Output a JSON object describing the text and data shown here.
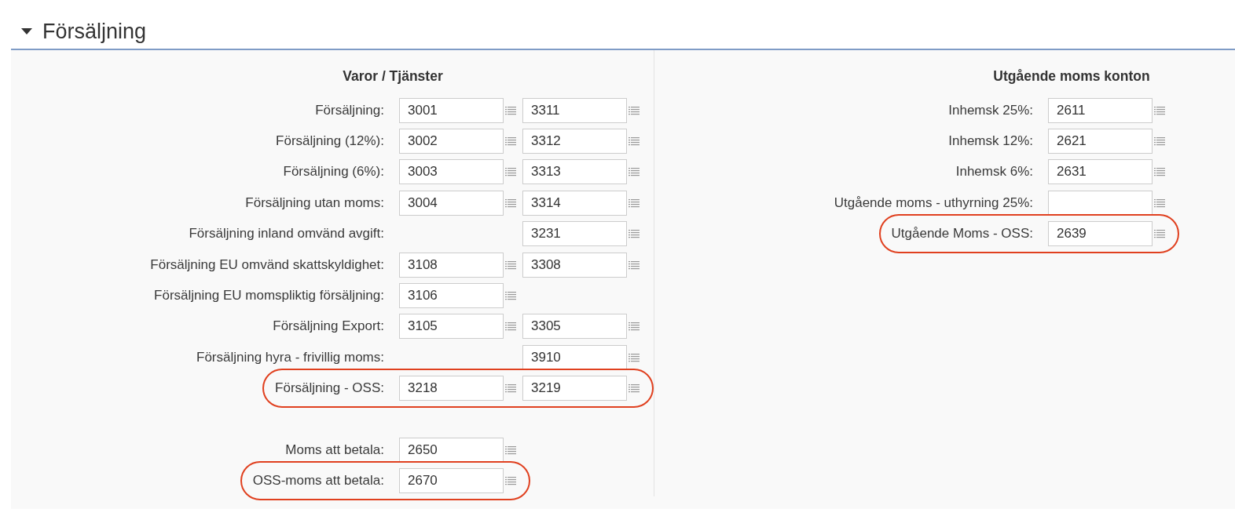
{
  "section": {
    "title": "Försäljning",
    "expanded": true,
    "left": {
      "heading": "Varor / Tjänster",
      "rows": [
        {
          "label": "Försäljning:",
          "highlighted": false,
          "accounts": [
            {
              "kind": "field",
              "value": "3001"
            },
            {
              "kind": "field",
              "value": "3311"
            }
          ]
        },
        {
          "label": "Försäljning (12%):",
          "highlighted": false,
          "accounts": [
            {
              "kind": "field",
              "value": "3002"
            },
            {
              "kind": "field",
              "value": "3312"
            }
          ]
        },
        {
          "label": "Försäljning (6%):",
          "highlighted": false,
          "accounts": [
            {
              "kind": "field",
              "value": "3003"
            },
            {
              "kind": "field",
              "value": "3313"
            }
          ]
        },
        {
          "label": "Försäljning utan moms:",
          "highlighted": false,
          "accounts": [
            {
              "kind": "field",
              "value": "3004"
            },
            {
              "kind": "field",
              "value": "3314"
            }
          ]
        },
        {
          "label": "Försäljning inland omvänd avgift:",
          "highlighted": false,
          "accounts": [
            {
              "kind": "blank"
            },
            {
              "kind": "field",
              "value": "3231"
            }
          ]
        },
        {
          "label": "Försäljning EU omvänd skattskyldighet:",
          "highlighted": false,
          "accounts": [
            {
              "kind": "field",
              "value": "3108"
            },
            {
              "kind": "field",
              "value": "3308"
            }
          ]
        },
        {
          "label": "Försäljning EU momspliktig försäljning:",
          "highlighted": false,
          "accounts": [
            {
              "kind": "field",
              "value": "3106"
            },
            {
              "kind": "blank"
            }
          ]
        },
        {
          "label": "Försäljning Export:",
          "highlighted": false,
          "accounts": [
            {
              "kind": "field",
              "value": "3105"
            },
            {
              "kind": "field",
              "value": "3305"
            }
          ]
        },
        {
          "label": "Försäljning hyra - frivillig moms:",
          "highlighted": false,
          "accounts": [
            {
              "kind": "blank"
            },
            {
              "kind": "field",
              "value": "3910"
            }
          ]
        },
        {
          "label": "Försäljning - OSS:",
          "highlighted": true,
          "accounts": [
            {
              "kind": "field",
              "value": "3218"
            },
            {
              "kind": "field",
              "value": "3219"
            }
          ]
        }
      ],
      "payment_rows": [
        {
          "label": "Moms att betala:",
          "highlighted": false,
          "accounts": [
            {
              "kind": "field",
              "value": "2650"
            },
            {
              "kind": "blank"
            }
          ]
        },
        {
          "label": "OSS-moms att betala:",
          "highlighted": true,
          "accounts": [
            {
              "kind": "field",
              "value": "2670"
            },
            {
              "kind": "blank"
            }
          ]
        }
      ]
    },
    "right": {
      "heading": "Utgående moms konton",
      "rows": [
        {
          "label": "Inhemsk 25%:",
          "highlighted": false,
          "accounts": [
            {
              "kind": "field",
              "value": "2611"
            }
          ]
        },
        {
          "label": "Inhemsk 12%:",
          "highlighted": false,
          "accounts": [
            {
              "kind": "field",
              "value": "2621"
            }
          ]
        },
        {
          "label": "Inhemsk 6%:",
          "highlighted": false,
          "accounts": [
            {
              "kind": "field",
              "value": "2631"
            }
          ]
        },
        {
          "label": "Utgående moms - uthyrning 25%:",
          "highlighted": false,
          "accounts": [
            {
              "kind": "field"
            }
          ]
        },
        {
          "label": "Utgående Moms - OSS:",
          "highlighted": true,
          "accounts": [
            {
              "kind": "field",
              "value": "2639"
            }
          ]
        }
      ]
    }
  }
}
